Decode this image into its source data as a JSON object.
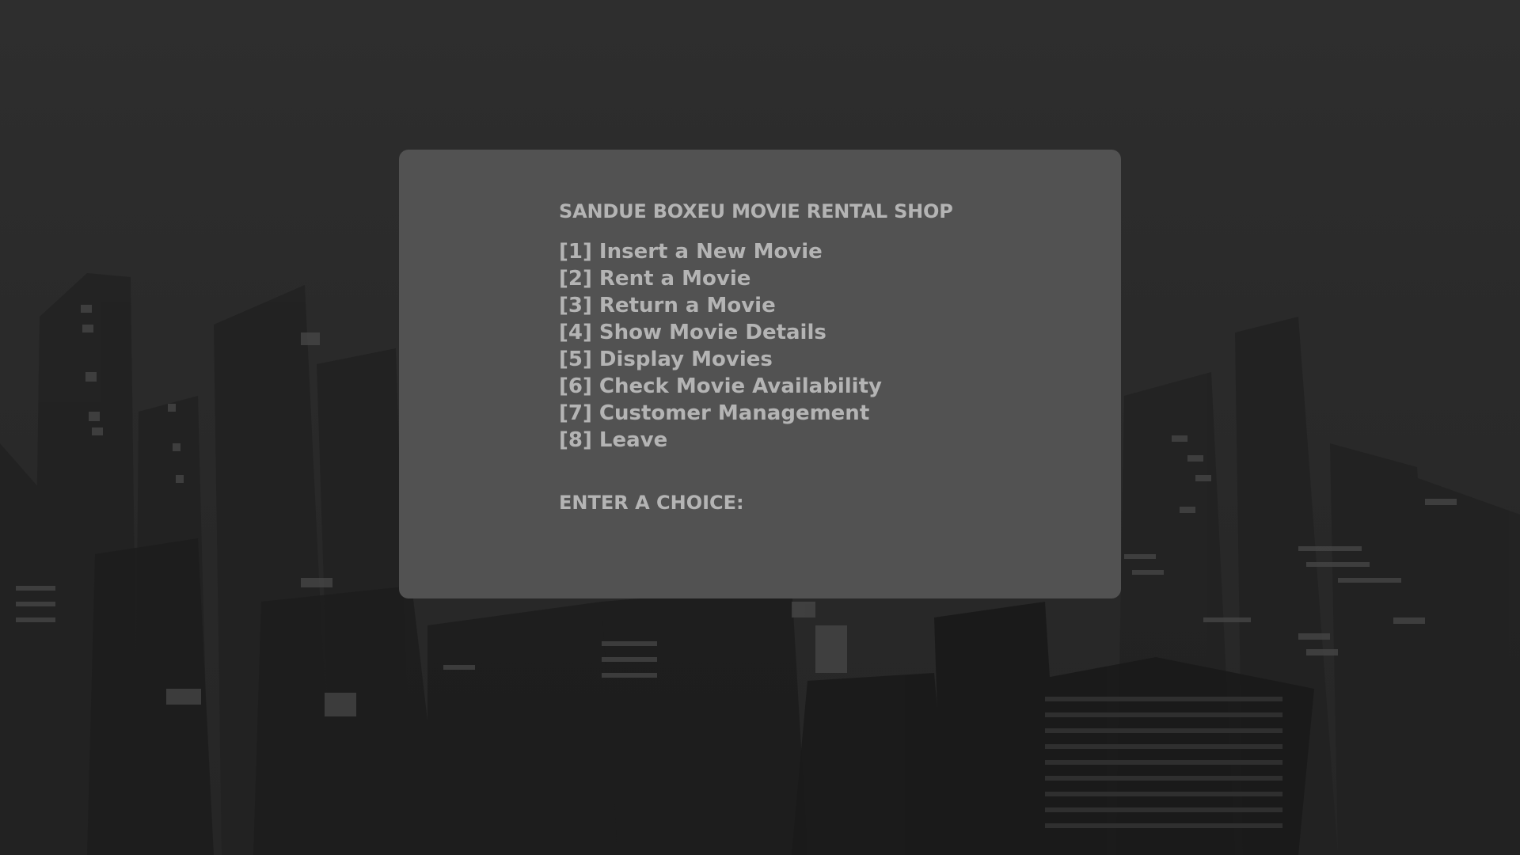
{
  "app": {
    "title": "SANDUE BOXEU MOVIE RENTAL SHOP"
  },
  "menu": {
    "items": [
      {
        "label": "[1] Insert a New Movie"
      },
      {
        "label": "[2] Rent a Movie"
      },
      {
        "label": "[3] Return a Movie"
      },
      {
        "label": "[4] Show Movie Details"
      },
      {
        "label": "[5] Display Movies"
      },
      {
        "label": "[6] Check Movie Availability"
      },
      {
        "label": "[7] Customer Management"
      },
      {
        "label": "[8] Leave"
      }
    ]
  },
  "prompt": {
    "label": "ENTER A CHOICE:"
  },
  "colors": {
    "background": "#2b2b2b",
    "panel": "#525252",
    "text": "#b4b4b4",
    "buildings": "#1f1f1f"
  }
}
